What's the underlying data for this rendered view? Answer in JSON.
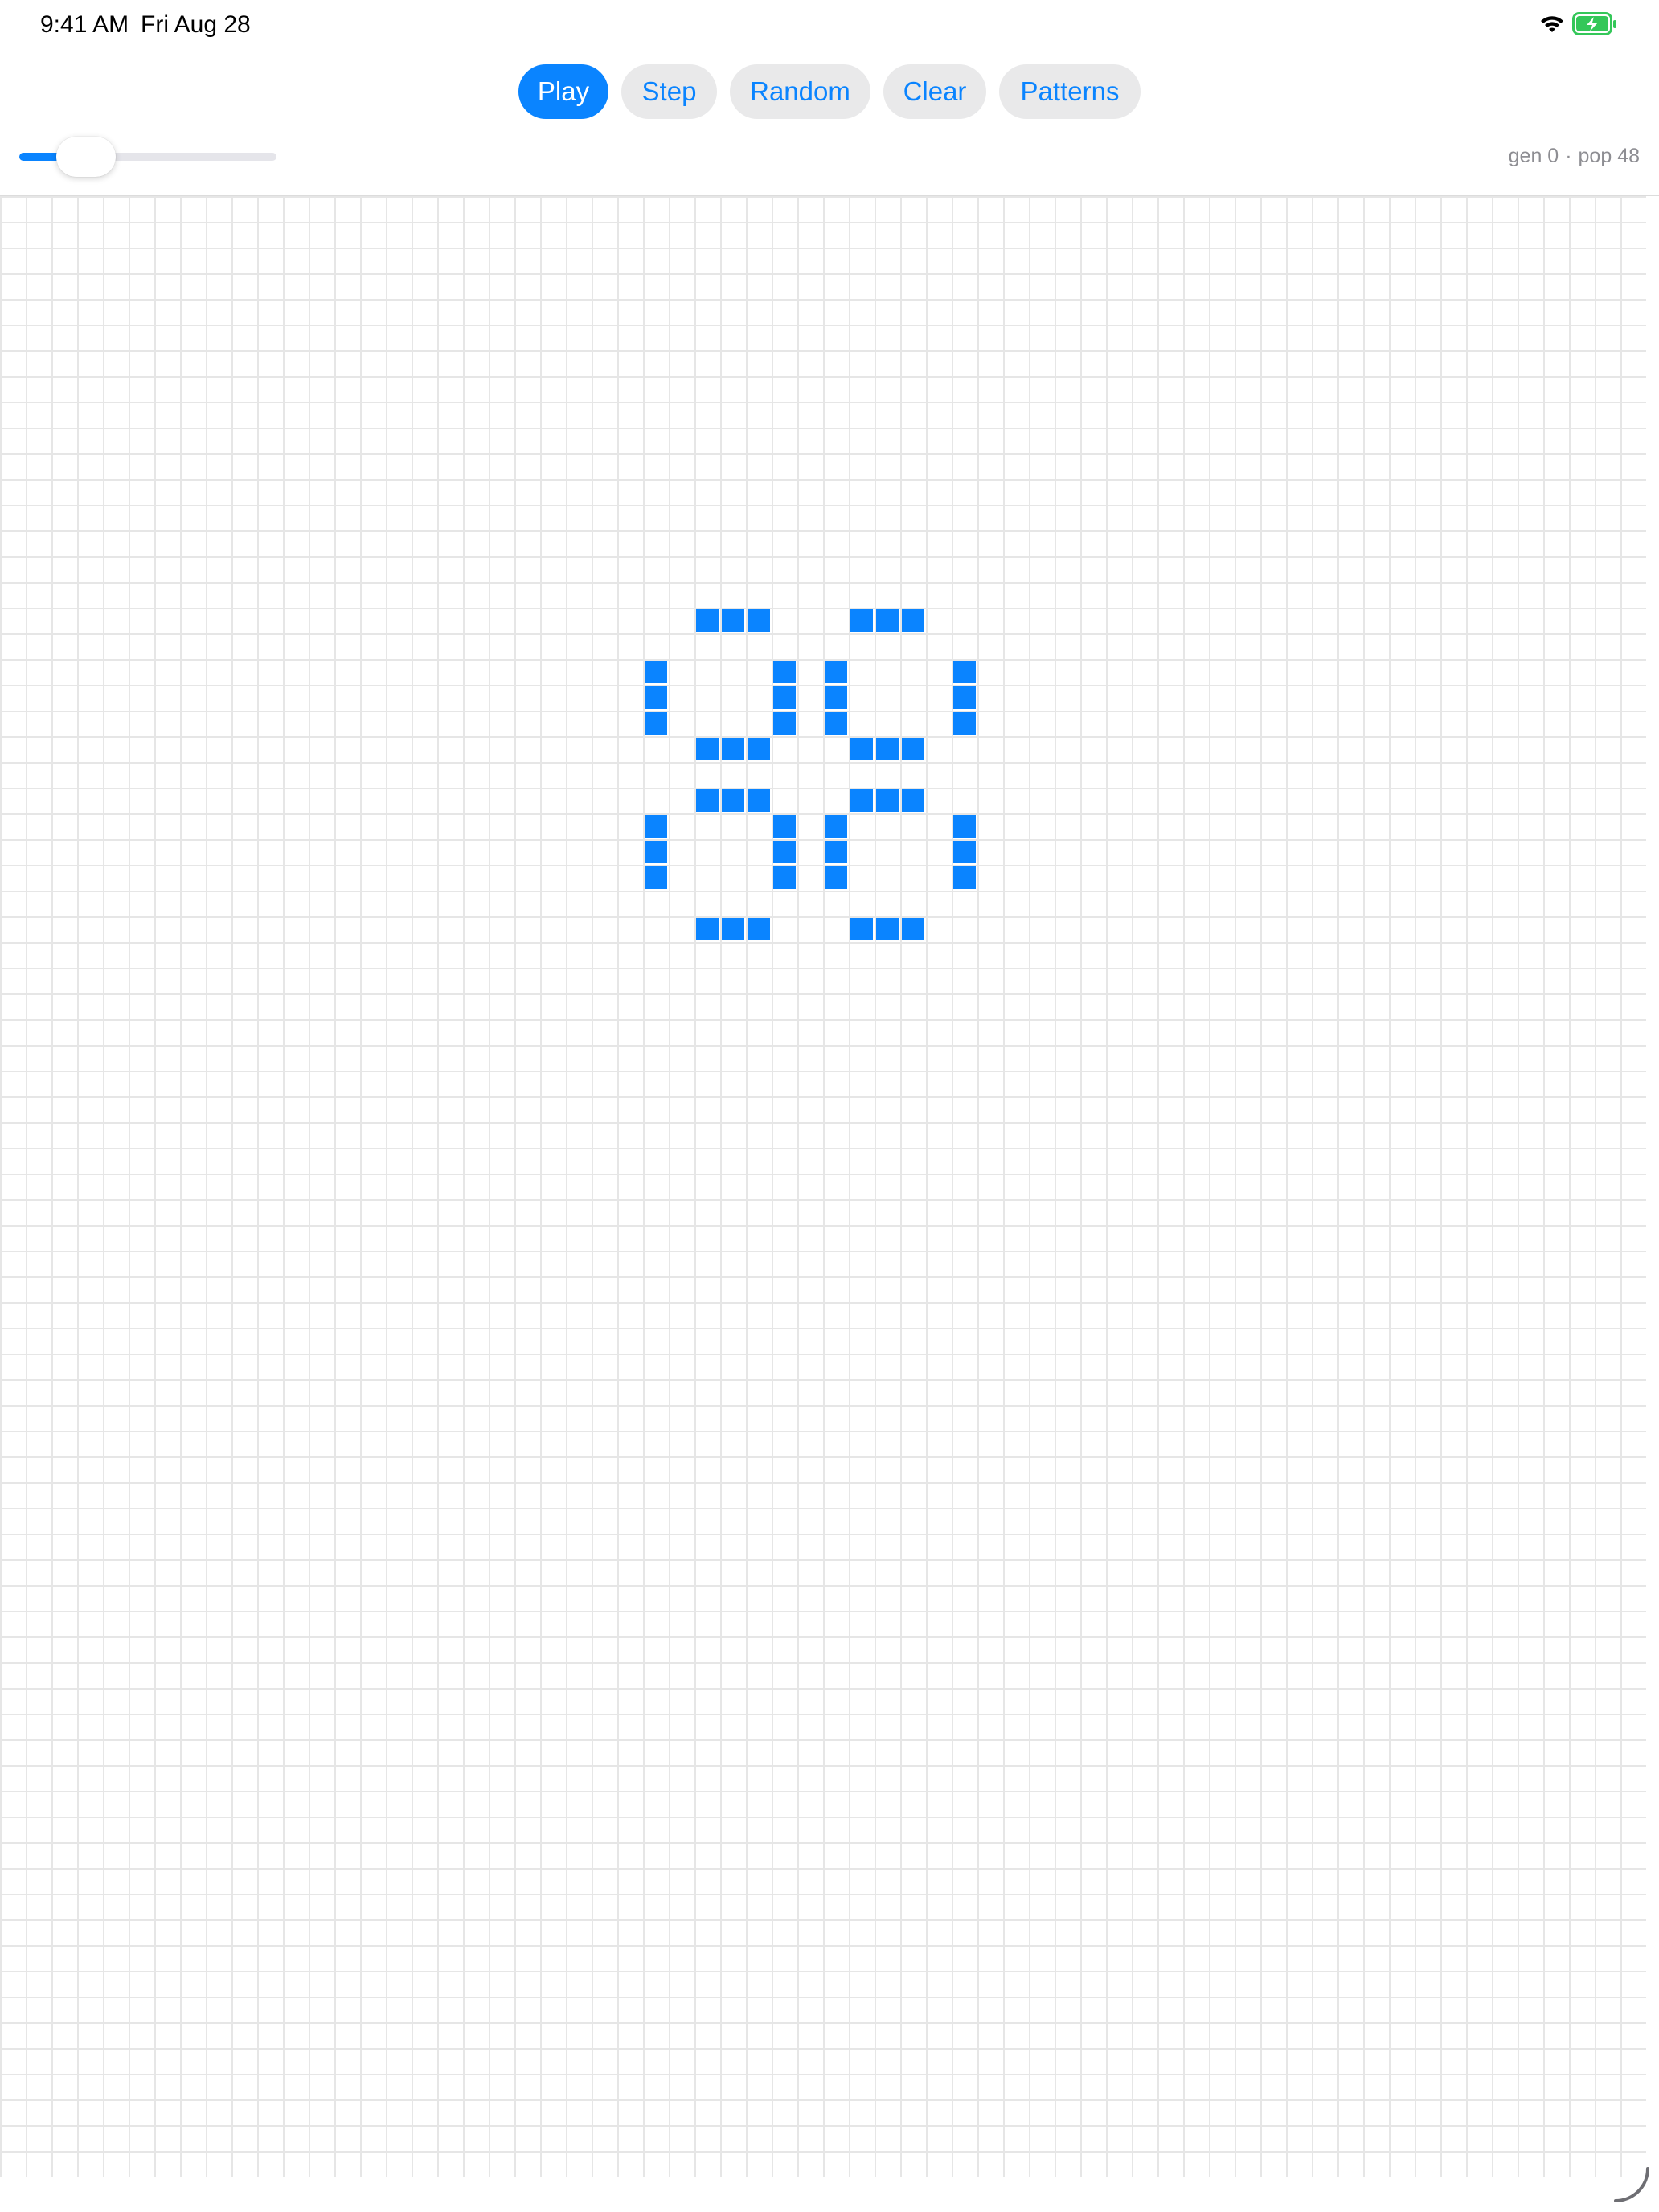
{
  "status_bar": {
    "time": "9:41 AM",
    "date": "Fri Aug 28",
    "icons": [
      "wifi-icon",
      "battery-charging-icon"
    ],
    "battery_color": "#34c759"
  },
  "toolbar": {
    "buttons": [
      {
        "label": "Play",
        "primary": true
      },
      {
        "label": "Step",
        "primary": false
      },
      {
        "label": "Random",
        "primary": false
      },
      {
        "label": "Clear",
        "primary": false
      },
      {
        "label": "Patterns",
        "primary": false
      }
    ]
  },
  "speed_slider": {
    "value": 0.26
  },
  "stats": {
    "generation": "gen 0",
    "separator": "·",
    "population": "pop 48"
  },
  "grid": {
    "columns": 64,
    "rows": 77,
    "live_cells": [
      [
        27,
        16
      ],
      [
        28,
        16
      ],
      [
        29,
        16
      ],
      [
        33,
        16
      ],
      [
        34,
        16
      ],
      [
        35,
        16
      ],
      [
        25,
        18
      ],
      [
        30,
        18
      ],
      [
        32,
        18
      ],
      [
        37,
        18
      ],
      [
        25,
        19
      ],
      [
        30,
        19
      ],
      [
        32,
        19
      ],
      [
        37,
        19
      ],
      [
        25,
        20
      ],
      [
        30,
        20
      ],
      [
        32,
        20
      ],
      [
        37,
        20
      ],
      [
        27,
        21
      ],
      [
        28,
        21
      ],
      [
        29,
        21
      ],
      [
        33,
        21
      ],
      [
        34,
        21
      ],
      [
        35,
        21
      ],
      [
        27,
        23
      ],
      [
        28,
        23
      ],
      [
        29,
        23
      ],
      [
        33,
        23
      ],
      [
        34,
        23
      ],
      [
        35,
        23
      ],
      [
        25,
        24
      ],
      [
        30,
        24
      ],
      [
        32,
        24
      ],
      [
        37,
        24
      ],
      [
        25,
        25
      ],
      [
        30,
        25
      ],
      [
        32,
        25
      ],
      [
        37,
        25
      ],
      [
        25,
        26
      ],
      [
        30,
        26
      ],
      [
        32,
        26
      ],
      [
        37,
        26
      ],
      [
        27,
        28
      ],
      [
        28,
        28
      ],
      [
        29,
        28
      ],
      [
        33,
        28
      ],
      [
        34,
        28
      ],
      [
        35,
        28
      ]
    ]
  },
  "colors": {
    "accent": "#0a84ff",
    "grid_line": "#e6e6e6",
    "button_bg": "#e9e9ea"
  }
}
